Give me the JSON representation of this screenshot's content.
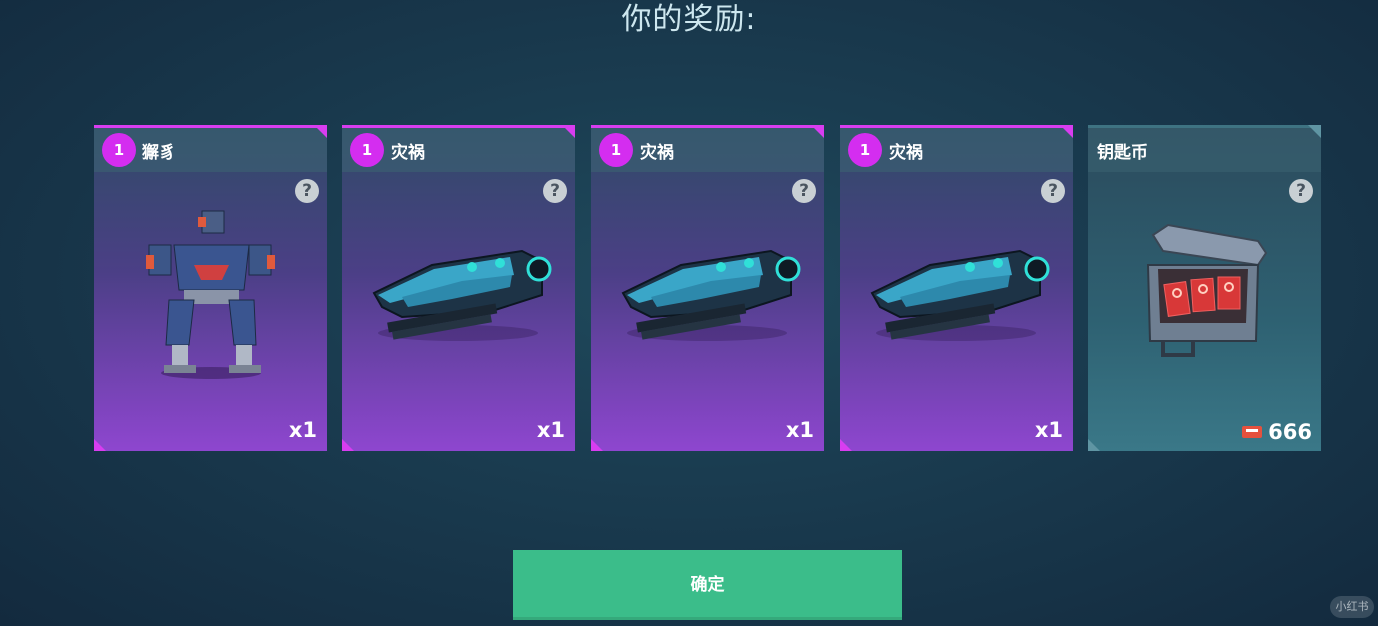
{
  "title": "你的奖励:",
  "cards": [
    {
      "badge": "1",
      "name": "獬豸",
      "quantity": "x1",
      "kind": "robot"
    },
    {
      "badge": "1",
      "name": "灾祸",
      "quantity": "x1",
      "kind": "weapon"
    },
    {
      "badge": "1",
      "name": "灾祸",
      "quantity": "x1",
      "kind": "weapon"
    },
    {
      "badge": "1",
      "name": "灾祸",
      "quantity": "x1",
      "kind": "weapon"
    },
    {
      "badge": "",
      "name": "钥匙币",
      "quantity": "666",
      "kind": "key-chest"
    }
  ],
  "help_symbol": "?",
  "confirm_label": "确定",
  "watermark": "小红书",
  "colors": {
    "rarity_accent": "#d83df0",
    "confirm_button": "#3bbd8a",
    "badge": "#d42df0"
  }
}
